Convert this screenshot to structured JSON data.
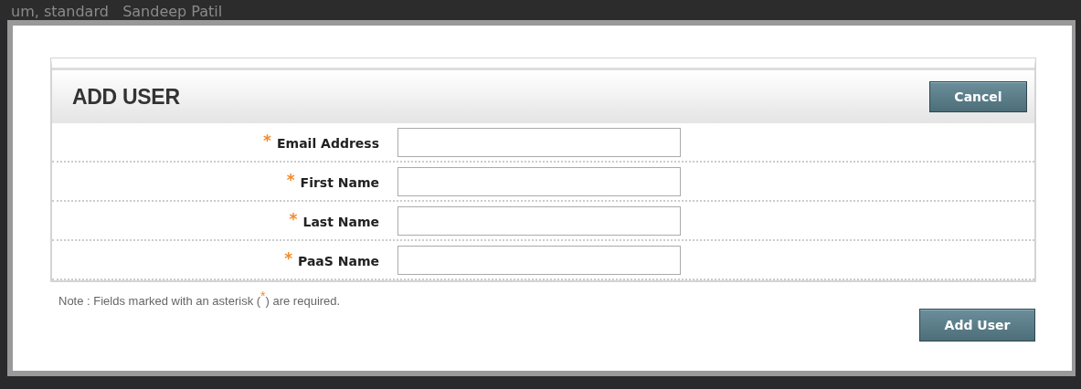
{
  "background": {
    "text": "um, standard   Sandeep Patil"
  },
  "dialog": {
    "title": "ADD USER",
    "cancel_button": "Cancel",
    "fields": [
      {
        "label": "Email Address",
        "required": true,
        "required_mark": "*"
      },
      {
        "label": "First Name",
        "required": true,
        "required_mark": "*"
      },
      {
        "label": "Last Name",
        "required": true,
        "required_mark": "*"
      },
      {
        "label": "PaaS Name",
        "required": true,
        "required_mark": "*"
      }
    ],
    "note": "Note : Fields marked with an asterisk ($^{*}$) are required.",
    "submit_button": "Add User"
  }
}
